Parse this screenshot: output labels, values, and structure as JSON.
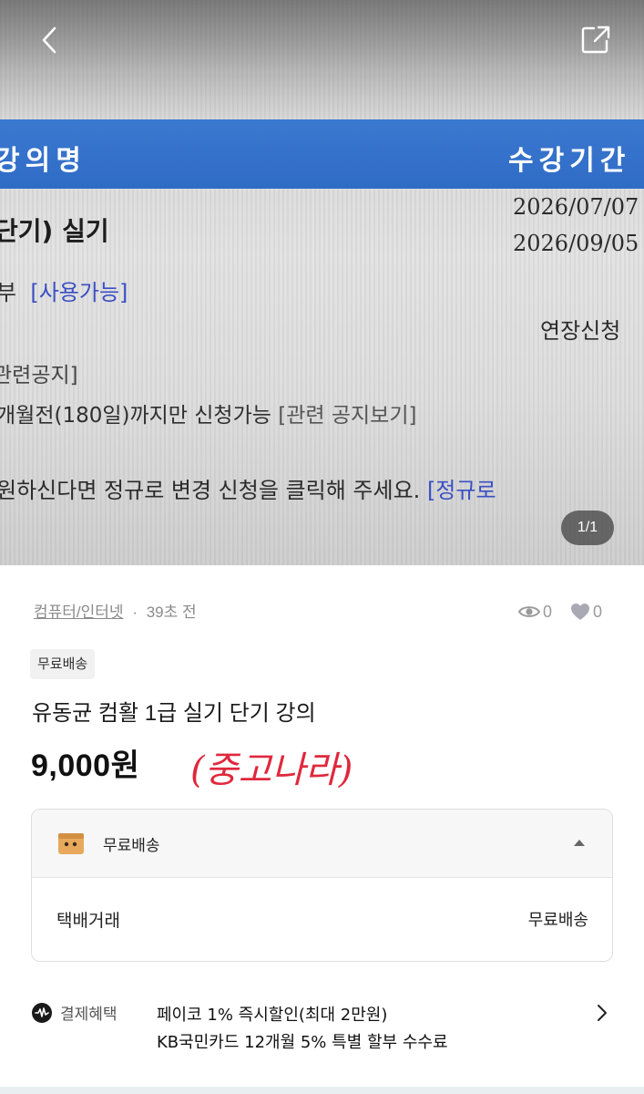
{
  "photo": {
    "header_left": "강의명",
    "header_right": "수강기간",
    "course_title": "단기) 실기",
    "date_start": "2026/07/07",
    "date_end": "2026/09/05",
    "usable_prefix": "부",
    "usable_badge": "[사용가능]",
    "extension": "연장신청",
    "notice": "관련공지]",
    "period_text": "개월전(180일)까지만 신청가능",
    "period_link": "[관련 공지보기]",
    "regular_text": "원하신다면 정규로 변경 신청을 클릭해 주세요.",
    "regular_link": "[정규로",
    "counter": "1/1"
  },
  "meta": {
    "category": "컴퓨터/인터넷",
    "separator": "·",
    "time": "39초 전",
    "views": "0",
    "likes": "0"
  },
  "tag": "무료배송",
  "title": "유동균 컴활 1급 실기 단기 강의",
  "price": "9,000원",
  "handwritten_note": "(중고나라)",
  "shipping": {
    "header_label": "무료배송",
    "row_label": "택배거래",
    "row_value": "무료배송"
  },
  "payment": {
    "label": "결제혜택",
    "line1": "페이코 1% 즉시할인(최대 2만원)",
    "line2": "KB국민카드 12개월 5% 특별 할부 수수료"
  },
  "colors": {
    "photo_blue_band": "#2f6cc6",
    "handwriting_red": "#e0283c",
    "link_blue": "#3a4fc4"
  }
}
